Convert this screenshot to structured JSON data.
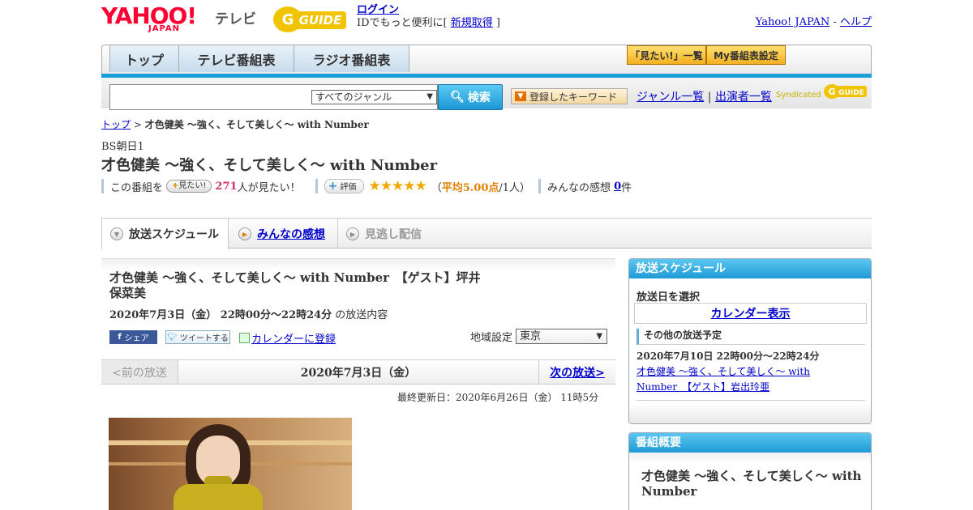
{
  "header": {
    "yahoo_logo": "YAHOO!",
    "yahoo_sub": "JAPAN",
    "tv_label": "テレビ",
    "gguide_logo": "G GUIDE",
    "login_link": "ログイン",
    "login_text_pre": "IDでもっと便利に[ ",
    "signup_link": "新規取得",
    "login_text_post": " ]",
    "yahoo_japan_link": "Yahoo! JAPAN",
    "right_sep": " - ",
    "help_link": "ヘルプ"
  },
  "nav": {
    "tabs": [
      {
        "label": "トップ"
      },
      {
        "label": "テレビ番組表"
      },
      {
        "label": "ラジオ番組表"
      }
    ],
    "mitai_list": "「見たい!」一覧",
    "my_schedule": "My番組表設定"
  },
  "search": {
    "input_value": "",
    "genre_selected": "すべてのジャンル",
    "search_button": "検索",
    "keyword_button": "登録したキーワード",
    "genre_list_link": "ジャンル一覧",
    "link_sep": " | ",
    "performer_list_link": "出演者一覧",
    "syndicated": "Syndicated"
  },
  "breadcrumb": {
    "top": "トップ",
    "sep": " > ",
    "current": "才色健美 ～強く、そして美しく～ with Number"
  },
  "program": {
    "channel": "BS朝日1",
    "title": "才色健美 ～強く、そして美しく～ with Number",
    "mitai_pre": "この番組を",
    "mitai_button": "見たい!",
    "mitai_count": "271",
    "mitai_post": "人が見たい！",
    "hyoka_button": "評価",
    "stars": "★★★★★",
    "rating_pre": "（",
    "rating_avg": "平均5.00点",
    "rating_post": "/1人）",
    "review_label": "みんなの感想",
    "review_count": "0",
    "review_unit": "件"
  },
  "content_tabs": [
    {
      "label": "放送スケジュール"
    },
    {
      "label": "みんなの感想"
    },
    {
      "label": "見逃し配信"
    }
  ],
  "episode": {
    "title": "才色健美 ～強く、そして美しく～ with Number　【ゲスト】坪井保菜美",
    "date_time": "2020年7月3日（金） 22時00分～22時24分",
    "date_suffix": " の放送内容",
    "facebook_share": "シェア",
    "tweet": "ツイートする",
    "calendar_register": "カレンダーに登録",
    "region_label": "地域設定",
    "region_selected": "東京"
  },
  "pager": {
    "prev": "<前の放送",
    "current": "2020年7月3日（金）",
    "next": "次の放送>"
  },
  "updated": "最終更新日：2020年6月26日（金） 11時5分",
  "sidebar_schedule": {
    "header": "放送スケジュール",
    "select_date": "放送日を選択",
    "calendar_button": "カレンダー表示",
    "other_header": "その他の放送予定",
    "other_date": "2020年7月10日 22時00分～22時24分",
    "other_link": "才色健美 ～強く、そして美しく～ with Number　【ゲスト】岩出玲亜"
  },
  "sidebar_summary": {
    "header": "番組概要",
    "title": "才色健美 ～強く、そして美しく～ with Number"
  },
  "colors": {
    "accent_blue": "#1a9fd9",
    "link": "#0000cc",
    "yahoo_red": "#ff0033",
    "star_gold": "#f0a800",
    "count_pink": "#d6336c"
  }
}
